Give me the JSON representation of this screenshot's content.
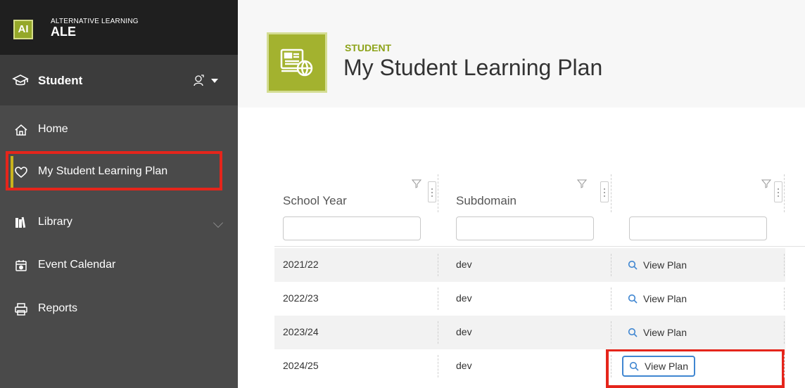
{
  "brand": {
    "logo_text": "AI",
    "small": "ALTERNATIVE LEARNING",
    "big": "ALE"
  },
  "role": {
    "label": "Student",
    "icon": "graduation-cap-icon"
  },
  "nav": {
    "items": [
      {
        "label": "Home",
        "icon": "home-icon"
      },
      {
        "label": "My Student Learning Plan",
        "icon": "heart-icon",
        "active": true
      },
      {
        "label": "Library",
        "icon": "books-icon",
        "expandable": true
      },
      {
        "label": "Event Calendar",
        "icon": "calendar-icon"
      },
      {
        "label": "Reports",
        "icon": "printer-icon"
      }
    ]
  },
  "header": {
    "kicker": "STUDENT",
    "title": "My Student Learning Plan",
    "icon": "learning-plan-icon"
  },
  "grid": {
    "columns": [
      "School Year",
      "Subdomain",
      ""
    ],
    "rows": [
      {
        "school_year": "2021/22",
        "subdomain": "dev",
        "action": "View Plan"
      },
      {
        "school_year": "2022/23",
        "subdomain": "dev",
        "action": "View Plan"
      },
      {
        "school_year": "2023/24",
        "subdomain": "dev",
        "action": "View Plan"
      },
      {
        "school_year": "2024/25",
        "subdomain": "dev",
        "action": "View Plan"
      }
    ]
  },
  "colors": {
    "sidebar": "#4a4a4a",
    "brand_bg": "#1f1f1f",
    "accent": "#a3b22f",
    "highlight": "#e5251b",
    "focus": "#3f86d1"
  }
}
